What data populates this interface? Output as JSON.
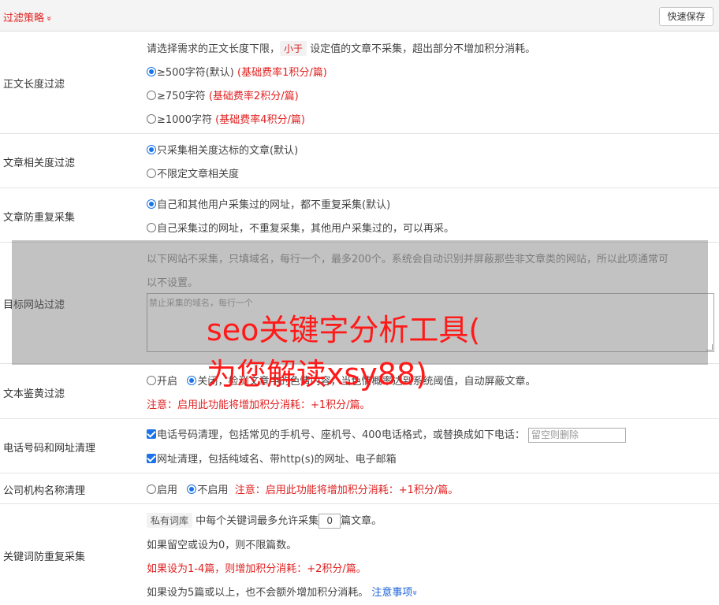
{
  "header": {
    "title": "过滤策略",
    "chevron": "»",
    "save_label": "快速保存"
  },
  "length_filter": {
    "label": "正文长度过滤",
    "desc_prefix": "请选择需求的正文长度下限，",
    "desc_tag": "小于",
    "desc_suffix": "设定值的文章不采集，超出部分不增加积分消耗。",
    "options": [
      {
        "text": "≥500字符(默认)",
        "note": "(基础费率1积分/篇)",
        "selected": true
      },
      {
        "text": "≥750字符",
        "note": "(基础费率2积分/篇)",
        "selected": false
      },
      {
        "text": "≥1000字符",
        "note": "(基础费率4积分/篇)",
        "selected": false
      }
    ]
  },
  "relevance_filter": {
    "label": "文章相关度过滤",
    "options": [
      {
        "text": "只采集相关度达标的文章(默认)",
        "selected": true
      },
      {
        "text": "不限定文章相关度",
        "selected": false
      }
    ]
  },
  "dup_filter": {
    "label": "文章防重复采集",
    "options": [
      {
        "text": "自己和其他用户采集过的网址，都不重复采集(默认)",
        "selected": true
      },
      {
        "text": "自己采集过的网址，不重复采集，其他用户采集过的，可以再采。",
        "selected": false
      }
    ]
  },
  "site_filter": {
    "label": "目标网站过滤",
    "desc_line1": "以下网站不采集，只填域名，每行一个，最多200个。系统会自动识别并屏蔽那些非文章类的网站，所以此项通常可",
    "desc_line2": "以不设置。",
    "placeholder": "禁止采集的域名，每行一个"
  },
  "yellow_filter": {
    "label": "文本鉴黄过滤",
    "on_label": "开启",
    "off_label": "关闭",
    "desc": "，检测文章中的色情内容，当色情概率达到系统阈值，自动屏蔽文章。",
    "selected": "off",
    "note": "注意：启用此功能将增加积分消耗：+1积分/篇。"
  },
  "phone_filter": {
    "label": "电话号码和网址清理",
    "phone_text": "电话号码清理，包括常见的手机号、座机号、400电话格式，或替换成如下电话：",
    "phone_placeholder": "留空则删除",
    "url_text": "网址清理，包括纯域名、带http(s)的网址、电子邮箱"
  },
  "org_filter": {
    "label": "公司机构名称清理",
    "on_label": "启用",
    "off_label": "不启用",
    "selected": "off",
    "note": "注意：启用此功能将增加积分消耗：+1积分/篇。"
  },
  "keyword_dup": {
    "label": "关键词防重复采集",
    "tag": "私有词库",
    "text_before": "中每个关键词最多允许采集",
    "value": "0",
    "text_after": "篇文章。",
    "line2": "如果留空或设为0，则不限篇数。",
    "line3": "如果设为1-4篇，则增加积分消耗：+2积分/篇。",
    "line4": "如果设为5篇或以上，也不会额外增加积分消耗。",
    "link": "注意事项",
    "link_chevron": "»"
  },
  "watermark": {
    "line1": "seo关键字分析工具(",
    "line2": "为您解读xsy88)"
  }
}
